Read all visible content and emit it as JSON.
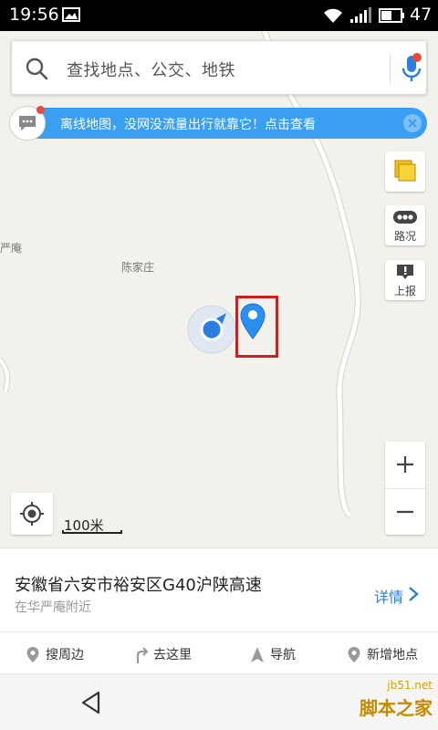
{
  "status_bar": {
    "time": "19:56",
    "battery": "47"
  },
  "search": {
    "placeholder": "查找地点、公交、地铁"
  },
  "banner": {
    "text": "离线地图，没网没流量出行就靠它！点击查看"
  },
  "side_buttons": {
    "traffic_label": "路况",
    "report_label": "上报"
  },
  "map": {
    "labels": [
      "陈家庄",
      "严庵"
    ],
    "scale": "100米"
  },
  "place": {
    "title": "安徽省六安市裕安区G40沪陕高速",
    "subtitle": "在华严庵附近",
    "details_label": "详情"
  },
  "actions": {
    "nearby": "搜周边",
    "goto": "去这里",
    "navigate": "导航",
    "add_place": "新增地点"
  },
  "watermark": {
    "site": "jb51.net",
    "brand": "脚本之家"
  },
  "colors": {
    "accent_blue": "#2a7ee0",
    "banner_blue": "#3a9ff0",
    "highlight_red": "#cc1f1f",
    "map_bg": "#f3f1ec"
  }
}
